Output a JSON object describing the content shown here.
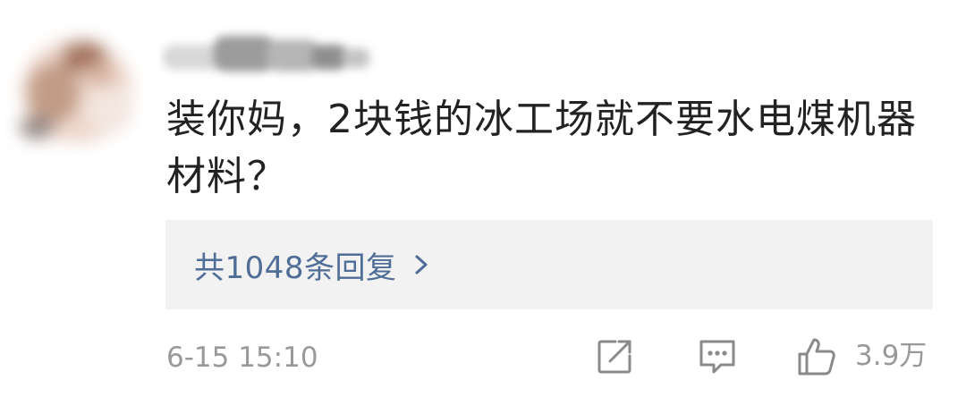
{
  "comment": {
    "text": "装你妈，2块钱的冰工场就不要水电煤机器材料？",
    "timestamp": "6-15 15:10",
    "replies_label": "共1048条回复",
    "like_count": "3.9万"
  },
  "icons": {
    "share": "share-icon",
    "reply": "comment-icon",
    "like": "thumbs-up-icon",
    "chevron": "chevron-right-icon"
  },
  "colors": {
    "text": "#222222",
    "link": "#4f6d96",
    "muted": "#999999",
    "reply_box_bg": "#f2f2f2"
  }
}
